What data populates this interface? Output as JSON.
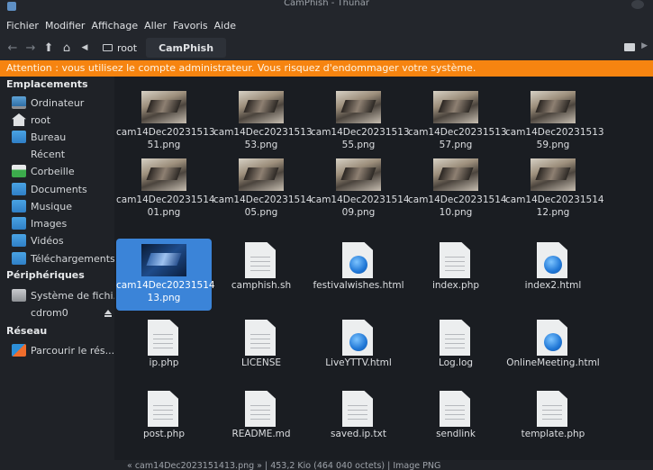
{
  "window": {
    "title": "CamPhish - Thunar"
  },
  "menu": [
    "Fichier",
    "Modifier",
    "Affichage",
    "Aller",
    "Favoris",
    "Aide"
  ],
  "path": {
    "parent": "root",
    "current": "CamPhish"
  },
  "warning": "Attention : vous utilisez le compte administrateur. Vous risquez d'endommager votre système.",
  "sidebar": {
    "places_header": "Emplacements",
    "places": [
      "Ordinateur",
      "root",
      "Bureau",
      "Récent",
      "Corbeille",
      "Documents",
      "Musique",
      "Images",
      "Vidéos",
      "Téléchargements"
    ],
    "devices_header": "Périphériques",
    "devices": [
      "Système de fichi...",
      "cdrom0"
    ],
    "network_header": "Réseau",
    "network": [
      "Parcourir le rés..."
    ]
  },
  "files": [
    {
      "line1": "cam14Dec20231513",
      "line2": "51.png",
      "kind": "image"
    },
    {
      "line1": "cam14Dec20231513",
      "line2": "53.png",
      "kind": "image"
    },
    {
      "line1": "cam14Dec20231513",
      "line2": "55.png",
      "kind": "image"
    },
    {
      "line1": "cam14Dec20231513",
      "line2": "57.png",
      "kind": "image"
    },
    {
      "line1": "cam14Dec20231513",
      "line2": "59.png",
      "kind": "image"
    },
    {
      "line1": "cam14Dec20231514",
      "line2": "01.png",
      "kind": "image"
    },
    {
      "line1": "cam14Dec20231514",
      "line2": "05.png",
      "kind": "image"
    },
    {
      "line1": "cam14Dec20231514",
      "line2": "09.png",
      "kind": "image"
    },
    {
      "line1": "cam14Dec20231514",
      "line2": "10.png",
      "kind": "image"
    },
    {
      "line1": "cam14Dec20231514",
      "line2": "12.png",
      "kind": "image"
    },
    {
      "line1": "cam14Dec20231514",
      "line2": "13.png",
      "kind": "image",
      "selected": true
    },
    {
      "line1": "camphish.sh",
      "line2": "",
      "kind": "text"
    },
    {
      "line1": "festivalwishes.html",
      "line2": "",
      "kind": "html"
    },
    {
      "line1": "index.php",
      "line2": "",
      "kind": "text"
    },
    {
      "line1": "index2.html",
      "line2": "",
      "kind": "html"
    },
    {
      "line1": "ip.php",
      "line2": "",
      "kind": "text"
    },
    {
      "line1": "LICENSE",
      "line2": "",
      "kind": "text"
    },
    {
      "line1": "LiveYTTV.html",
      "line2": "",
      "kind": "html"
    },
    {
      "line1": "Log.log",
      "line2": "",
      "kind": "text"
    },
    {
      "line1": "OnlineMeeting.html",
      "line2": "",
      "kind": "html"
    },
    {
      "line1": "post.php",
      "line2": "",
      "kind": "text"
    },
    {
      "line1": "README.md",
      "line2": "",
      "kind": "text"
    },
    {
      "line1": "saved.ip.txt",
      "line2": "",
      "kind": "text"
    },
    {
      "line1": "sendlink",
      "line2": "",
      "kind": "text"
    },
    {
      "line1": "template.php",
      "line2": "",
      "kind": "text"
    }
  ],
  "status": "« cam14Dec2023151413.png » | 453,2 Kio (464 040 octets) | Image PNG"
}
